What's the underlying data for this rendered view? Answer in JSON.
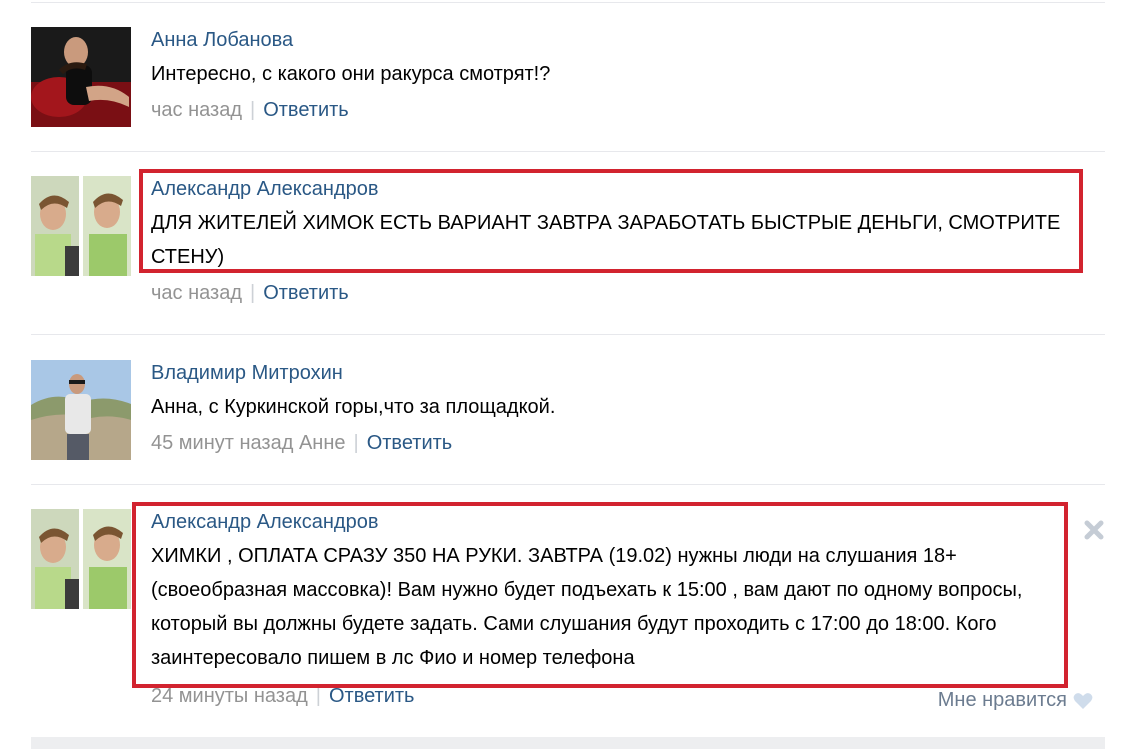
{
  "comments": [
    {
      "author": "Анна Лобанова",
      "text": "Интересно, с какого они ракурса смотрят!?",
      "time": "час назад",
      "reply": "Ответить",
      "avatar": "woman-in-black-dress-avatar"
    },
    {
      "author": "Александр Александров",
      "text": "ДЛЯ ЖИТЕЛЕЙ ХИМОК ЕСТЬ ВАРИАНТ ЗАВТРА ЗАРАБОТАТЬ БЫСТРЫЕ ДЕНЬГИ, СМОТРИТЕ СТЕНУ)",
      "time": "час назад",
      "reply": "Ответить",
      "avatar": "two-young-men-selfie-avatar",
      "highlighted": true
    },
    {
      "author": "Владимир Митрохин",
      "text": "Анна, с Куркинской горы,что за площадкой.",
      "time": "45 минут назад Анне",
      "reply": "Ответить",
      "avatar": "man-mountain-landscape-avatar"
    },
    {
      "author": "Александр Александров",
      "text": "ХИМКИ , ОПЛАТА СРАЗУ 350 НА РУКИ. ЗАВТРА (19.02) нужны люди на слушания 18+ (своеобразная массовка)! Вам нужно будет подъехать к 15:00 , вам дают по одному вопросы, который вы должны будете задать. Сами слушания будут проходить с 17:00 до 18:00. Кого заинтересовало пишем в лс Фио и номер телефона",
      "time": "24 минуты назад",
      "reply": "Ответить",
      "avatar": "two-young-men-selfie-avatar",
      "highlighted": true,
      "like_label": "Мне нравится"
    }
  ],
  "colors": {
    "author": "#2a5885",
    "meta": "#939393",
    "highlight_border": "#d2232f",
    "separator": "#e7e8ec"
  },
  "icons": {
    "delete": "close-x-icon",
    "like": "heart-icon"
  }
}
